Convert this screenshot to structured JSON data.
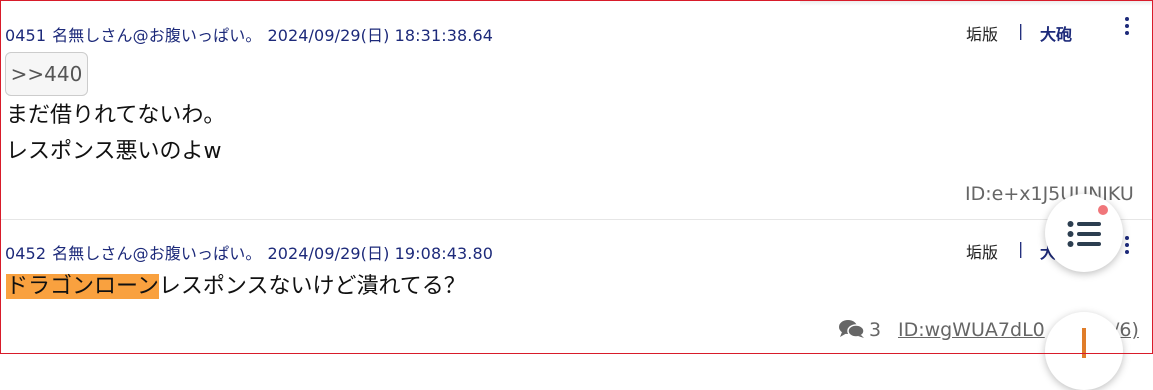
{
  "posts": [
    {
      "number": "0451",
      "name": "名無しさん@お腹いっぱい。",
      "datetime": "2024/09/29(日) 18:31:38.64",
      "kakoban": "垢版",
      "separator": "|",
      "taihou": "大砲",
      "anchor": ">>440",
      "lines": [
        "まだ借りれてないわ。",
        "レスポンス悪いのよw"
      ],
      "id": "ID:e+x1J5UUNIKU"
    },
    {
      "number": "0452",
      "name": "名無しさん@お腹いっぱい。",
      "datetime": "2024/09/29(日) 19:08:43.80",
      "kakoban": "垢版",
      "separator": "|",
      "taihou": "大",
      "highlight": "ドラゴンローン",
      "rest": "レスポンスないけど潰れてる？",
      "reply_count": "3",
      "id": "ID:wgWUA7dL0",
      "id_suffix": "/6)"
    }
  ],
  "colors": {
    "meta": "#1d2a7a",
    "highlight": "#f9a13f",
    "frame": "#d81b2a",
    "notification_dot": "#f0767a"
  },
  "icons": [
    "kebab-menu-icon",
    "comments-icon",
    "list-menu-icon"
  ]
}
